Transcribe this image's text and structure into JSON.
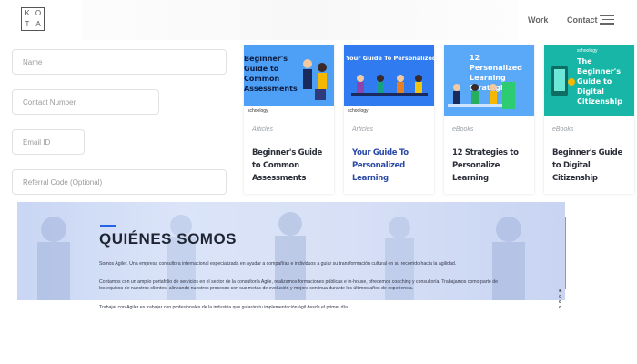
{
  "header": {
    "logo_letters": [
      "K",
      "O",
      "T",
      "A"
    ],
    "nav": {
      "work": "Work",
      "contact": "Contact"
    }
  },
  "form": {
    "name_placeholder": "Name",
    "phone_placeholder": "Contact Number",
    "email_placeholder": "Email ID",
    "referral_placeholder": "Referral Code (Optional)"
  },
  "cards": [
    {
      "thumb_title": "Beginner's Guide to Common Assessments",
      "brand": "schoology",
      "category": "Articles",
      "title": "Beginner's Guide to Common Assessments",
      "title_color": "#2c2f3a"
    },
    {
      "thumb_title": "Your Guide To Personalized Learning",
      "brand": "schoology",
      "category": "Articles",
      "title": "Your Guide To Personalized Learning",
      "title_color": "#2b4aa8"
    },
    {
      "thumb_title": "12 Personalized Learning Strategies",
      "brand": "",
      "category": "eBooks",
      "title": "12 Strategies to Personalize Learning",
      "title_color": "#2c2f3a"
    },
    {
      "thumb_title": "The Beginner's Guide to Digital Citizenship",
      "brand": "schoology",
      "category": "eBooks",
      "title": "Beginner's Guide to Digital Citizenship",
      "title_color": "#2c2f3a"
    }
  ],
  "banner": {
    "title": "QUIÉNES SOMOS",
    "p1": "Somos Agiler. Una empresa consultora internacional especializada en ayudar a compañías e individuos a guiar su transformación cultural en su recorrido hacia la agilidad.",
    "p2": "Contamos con un amplio portafolio de servicios en el sector de la consultoría Agile, realizamos formaciones públicas e in-house, ofrecemos coaching y consultoría. Trabajamos como parte de los equipos de nuestros clientes, alineando nuestros procesos con sus metas de evolución y mejora continua durante los últimos años de experiencia.",
    "p3": "Trabajar con Agiler es trabajar con profesionales de la industria que guiarán tu implementación ágil desde el primer día",
    "accent_color": "#2563eb"
  },
  "carousel": {
    "slides": 4,
    "active_index": 0
  }
}
